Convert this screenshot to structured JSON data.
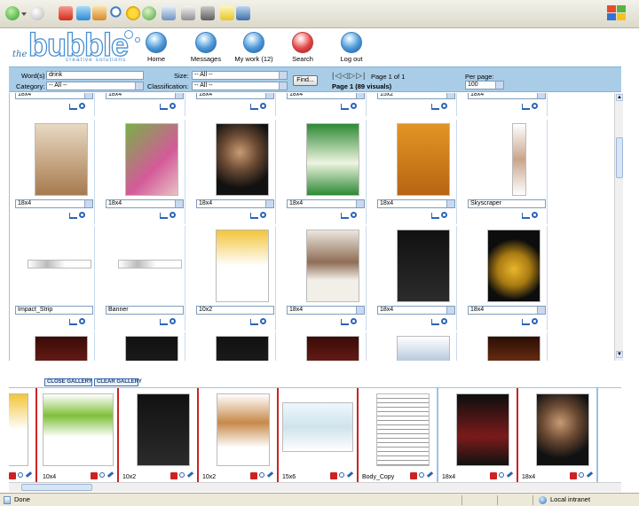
{
  "header": {
    "logo_the": "the",
    "logo_bubble": "bubble",
    "logo_tagline": "creative solutions",
    "nav": [
      {
        "label": "Home",
        "icon": "home-bubble-icon"
      },
      {
        "label": "Messages",
        "icon": "messages-bubble-icon"
      },
      {
        "label": "My work (12)",
        "icon": "my-work-bubble-icon"
      },
      {
        "label": "Search",
        "icon": "search-bubble-icon"
      },
      {
        "label": "Log out",
        "icon": "log-out-bubble-icon"
      }
    ]
  },
  "search": {
    "words_label": "Word(s)",
    "words_value": "drink",
    "category_label": "Category:",
    "category_value": "-- All --",
    "size_label": "Size:",
    "size_value": "-- All --",
    "classification_label": "Classification:",
    "classification_value": "-- All --",
    "find_label": "Find...",
    "page_label": "Page 1 of 1",
    "page_count": "Page 1 (89 visuals)",
    "per_page_label": "Per page:",
    "per_page_value": "100"
  },
  "gallery": {
    "top_row": [
      "18x4",
      "18x4",
      "18x4",
      "18x4",
      "15x2",
      "18x4"
    ],
    "row1": [
      {
        "size": "18x4",
        "img": "p-coffee"
      },
      {
        "size": "18x4",
        "img": "p-green"
      },
      {
        "size": "18x4",
        "img": "p-man"
      },
      {
        "size": "18x4",
        "img": "p-green2"
      },
      {
        "size": "18x4",
        "img": "p-orange"
      },
      {
        "size": "Skyscraper",
        "img": "p-sky"
      }
    ],
    "row2": [
      {
        "size": "Impact_Strip",
        "img": "p-strip"
      },
      {
        "size": "Banner",
        "img": "p-strip"
      },
      {
        "size": "10x2",
        "img": "p-yellow"
      },
      {
        "size": "18x4",
        "img": "p-woman"
      },
      {
        "size": "18x4",
        "img": "p-dark"
      },
      {
        "size": "18x4",
        "img": "p-beer"
      }
    ],
    "row3_imgs": [
      "p-red",
      "p-dark",
      "p-dark",
      "p-red",
      "p-blue",
      "p-fire"
    ]
  },
  "gallery_bar": {
    "close_label": "CLOSE GALLERY",
    "clear_label": "CLEAR GALLERY"
  },
  "strip": [
    {
      "label": "",
      "img": "p-yellow"
    },
    {
      "label": "10x4",
      "img": "p-gbag"
    },
    {
      "label": "10x2",
      "img": "p-dark"
    },
    {
      "label": "10x2",
      "img": "p-vase"
    },
    {
      "label": "15x6",
      "img": "p-bath"
    },
    {
      "label": "Body_Copy",
      "img": "p-text"
    },
    {
      "label": "18x4",
      "img": "p-car"
    },
    {
      "label": "18x4",
      "img": "p-man"
    }
  ],
  "status": {
    "left": "Done",
    "zone": "Local intranet"
  },
  "colors": {
    "search_bar": "#a9cde7",
    "accent_blue": "#4a8fd0",
    "strip_divider": "#cc2222"
  }
}
